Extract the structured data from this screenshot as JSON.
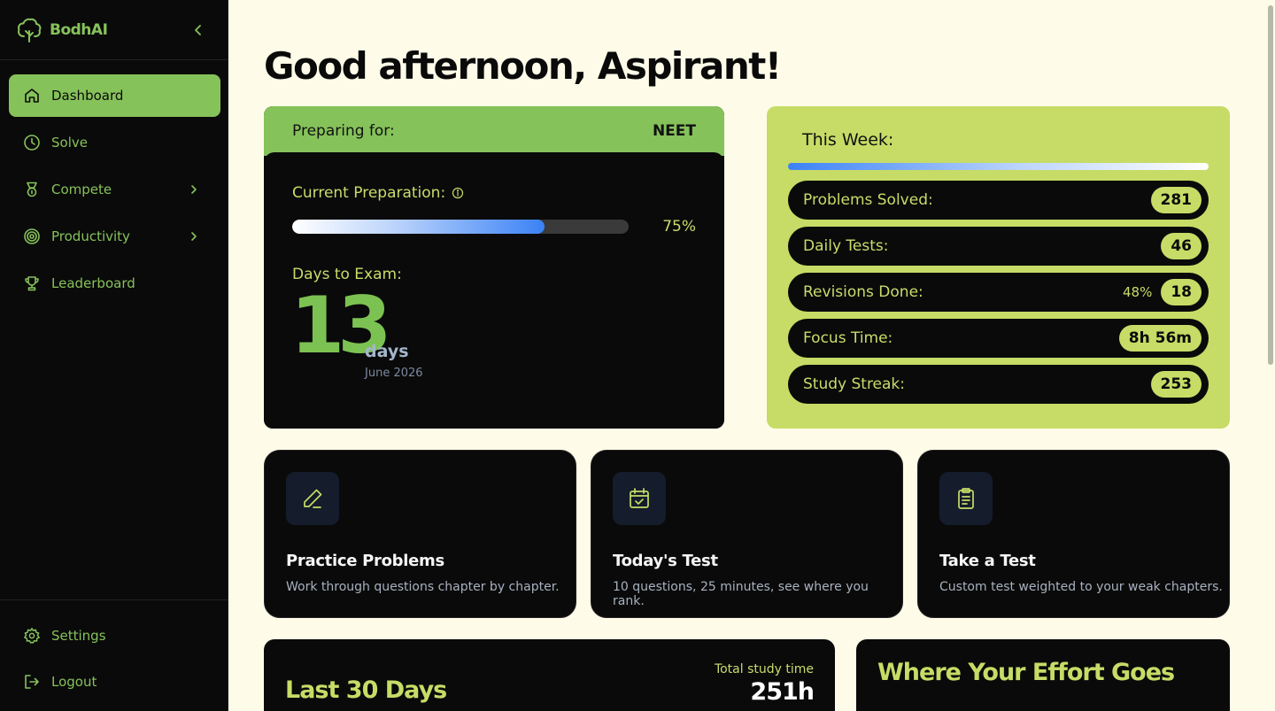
{
  "brand": {
    "name": "BodhAI",
    "logo_icon": "tree-icon",
    "accent": "#86c25a"
  },
  "sidebar": {
    "items": [
      {
        "label": "Dashboard",
        "icon": "home-icon",
        "active": true
      },
      {
        "label": "Solve",
        "icon": "clock-icon"
      },
      {
        "label": "Compete",
        "icon": "medal-icon",
        "has_submenu": true
      },
      {
        "label": "Productivity",
        "icon": "target-icon",
        "has_submenu": true
      },
      {
        "label": "Leaderboard",
        "icon": "trophy-icon"
      }
    ],
    "bottom": [
      {
        "label": "Settings",
        "icon": "gear-icon"
      },
      {
        "label": "Logout",
        "icon": "logout-icon"
      }
    ]
  },
  "greeting": "Good afternoon, Aspirant!",
  "prep": {
    "preparing_label": "Preparing for:",
    "exam": "NEET",
    "current_label": "Current Preparation:",
    "progress": 0.75,
    "progress_text": "75%",
    "days_label": "Days to Exam:",
    "days": "13",
    "days_unit": "days",
    "exam_date": "June 2026"
  },
  "week": {
    "title": "This Week:",
    "stats": [
      {
        "label": "Problems Solved:",
        "value": "281"
      },
      {
        "label": "Daily Tests:",
        "value": "46"
      },
      {
        "label": "Revisions Done:",
        "extra": "48%",
        "value": "18"
      },
      {
        "label": "Focus Time:",
        "value": "8h 56m"
      },
      {
        "label": "Study Streak:",
        "value": "253"
      }
    ]
  },
  "actions": [
    {
      "title": "Practice Problems",
      "desc": "Work through questions chapter by chapter.",
      "icon": "pencil-icon"
    },
    {
      "title": "Today's Test",
      "desc": "10 questions, 25 minutes, see where you rank.",
      "icon": "calendar-check-icon"
    },
    {
      "title": "Take a Test",
      "desc": "Custom test weighted to your weak chapters.",
      "icon": "clipboard-icon"
    }
  ],
  "last30": {
    "title": "Last 30 Days",
    "total_label": "Total study time",
    "total_value": "251h"
  },
  "effort": {
    "title": "Where Your Effort Goes"
  }
}
